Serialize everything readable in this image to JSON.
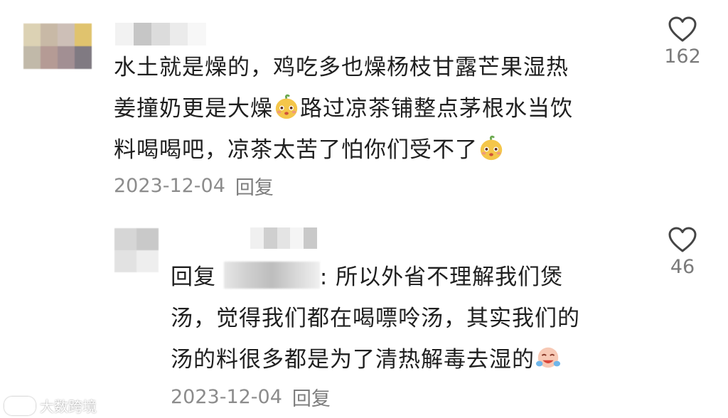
{
  "comments": [
    {
      "avatar_colors": [
        "#dcd2b4",
        "#c8b9a6",
        "#cdbfb7",
        "#e0c36e",
        "#c1b9a9",
        "#b59b95",
        "#a28f93",
        "#807a82"
      ],
      "name_blur_colors": [
        "#f2f2f2",
        "#c6c6c6",
        "#dcdcdc",
        "#ebebeb",
        "#f7f7f7"
      ],
      "text_lines": [
        "水土就是燥的，鸡吃多也燥杨枝甘露芒果湿热",
        "姜撞奶更是大燥",
        "路过凉茶铺整点茅根水当饮",
        "料喝喝吧，凉茶太苦了怕你们受不了"
      ],
      "emoji": "mango-face-emoji",
      "date": "2023-12-04",
      "reply_label": "回复",
      "likes": "162"
    },
    {
      "avatar_colors": [
        "#d6d6d6",
        "#c9c9c9",
        "#e2e2e2",
        "#eeeeee"
      ],
      "name_blur_colors": [
        "#f0f0f0",
        "#cfcfcf",
        "#e4e4e4",
        "#f5f5f5",
        "#c9c9c9"
      ],
      "reply_prefix": "回复",
      "reply_suffix": ": 所以外省不理解我们煲",
      "text_lines": [
        "汤，觉得我们都在喝嘌呤汤，其实我们的",
        "汤的料很多都是为了清热解毒去湿的"
      ],
      "emoji": "crying-laughing-emoji",
      "date": "2023-12-04",
      "reply_label": "回复",
      "likes": "46"
    }
  ],
  "watermark": "大数跨境",
  "icons": {
    "like": "heart-outline-icon"
  },
  "colors": {
    "text": "#1f1f1f",
    "meta": "#8c8c8c",
    "icon": "#444444"
  }
}
